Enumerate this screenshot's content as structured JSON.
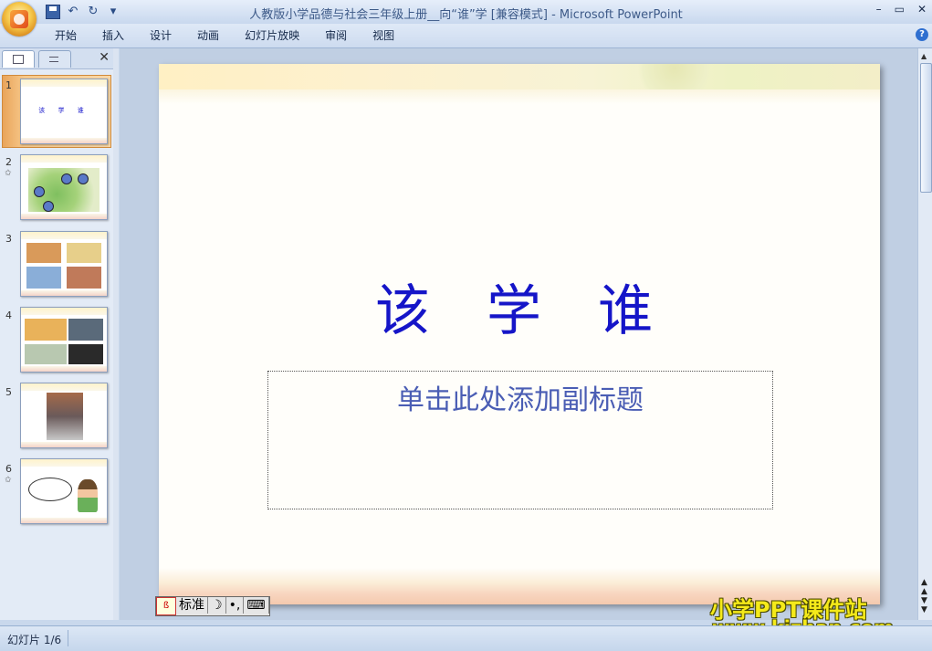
{
  "window": {
    "title": "人教版小学品德与社会三年级上册__向“谁”学 [兼容模式] - Microsoft PowerPoint",
    "controls": [
      "–",
      "▭",
      "✕"
    ]
  },
  "ribbon": {
    "tabs": [
      "开始",
      "插入",
      "设计",
      "动画",
      "幻灯片放映",
      "审阅",
      "视图"
    ],
    "help": "?"
  },
  "qat": {
    "undo": "↶",
    "redo": "↻",
    "more": "▾"
  },
  "thumbnails": [
    {
      "num": "1",
      "selected": true,
      "text": "该 学 谁",
      "star": ""
    },
    {
      "num": "2",
      "selected": false,
      "star": "✩"
    },
    {
      "num": "3",
      "selected": false,
      "star": ""
    },
    {
      "num": "4",
      "selected": false,
      "star": ""
    },
    {
      "num": "5",
      "selected": false,
      "star": ""
    },
    {
      "num": "6",
      "selected": false,
      "star": "✩"
    }
  ],
  "slide": {
    "title": "该学谁",
    "subtitle_placeholder": "单击此处添加副标题"
  },
  "ime": {
    "logo": "ß",
    "mode": "标准",
    "moon": "☽",
    "punct": "•,",
    "kbd": "⌨"
  },
  "watermark": {
    "line1": "小学PPT课件站",
    "line2": "www.kjzhan.com"
  },
  "status": {
    "slide_counter": "幻灯片 1/6"
  },
  "colors": {
    "title_blue": "#1515c8",
    "selection_orange": "#e9a45a"
  }
}
